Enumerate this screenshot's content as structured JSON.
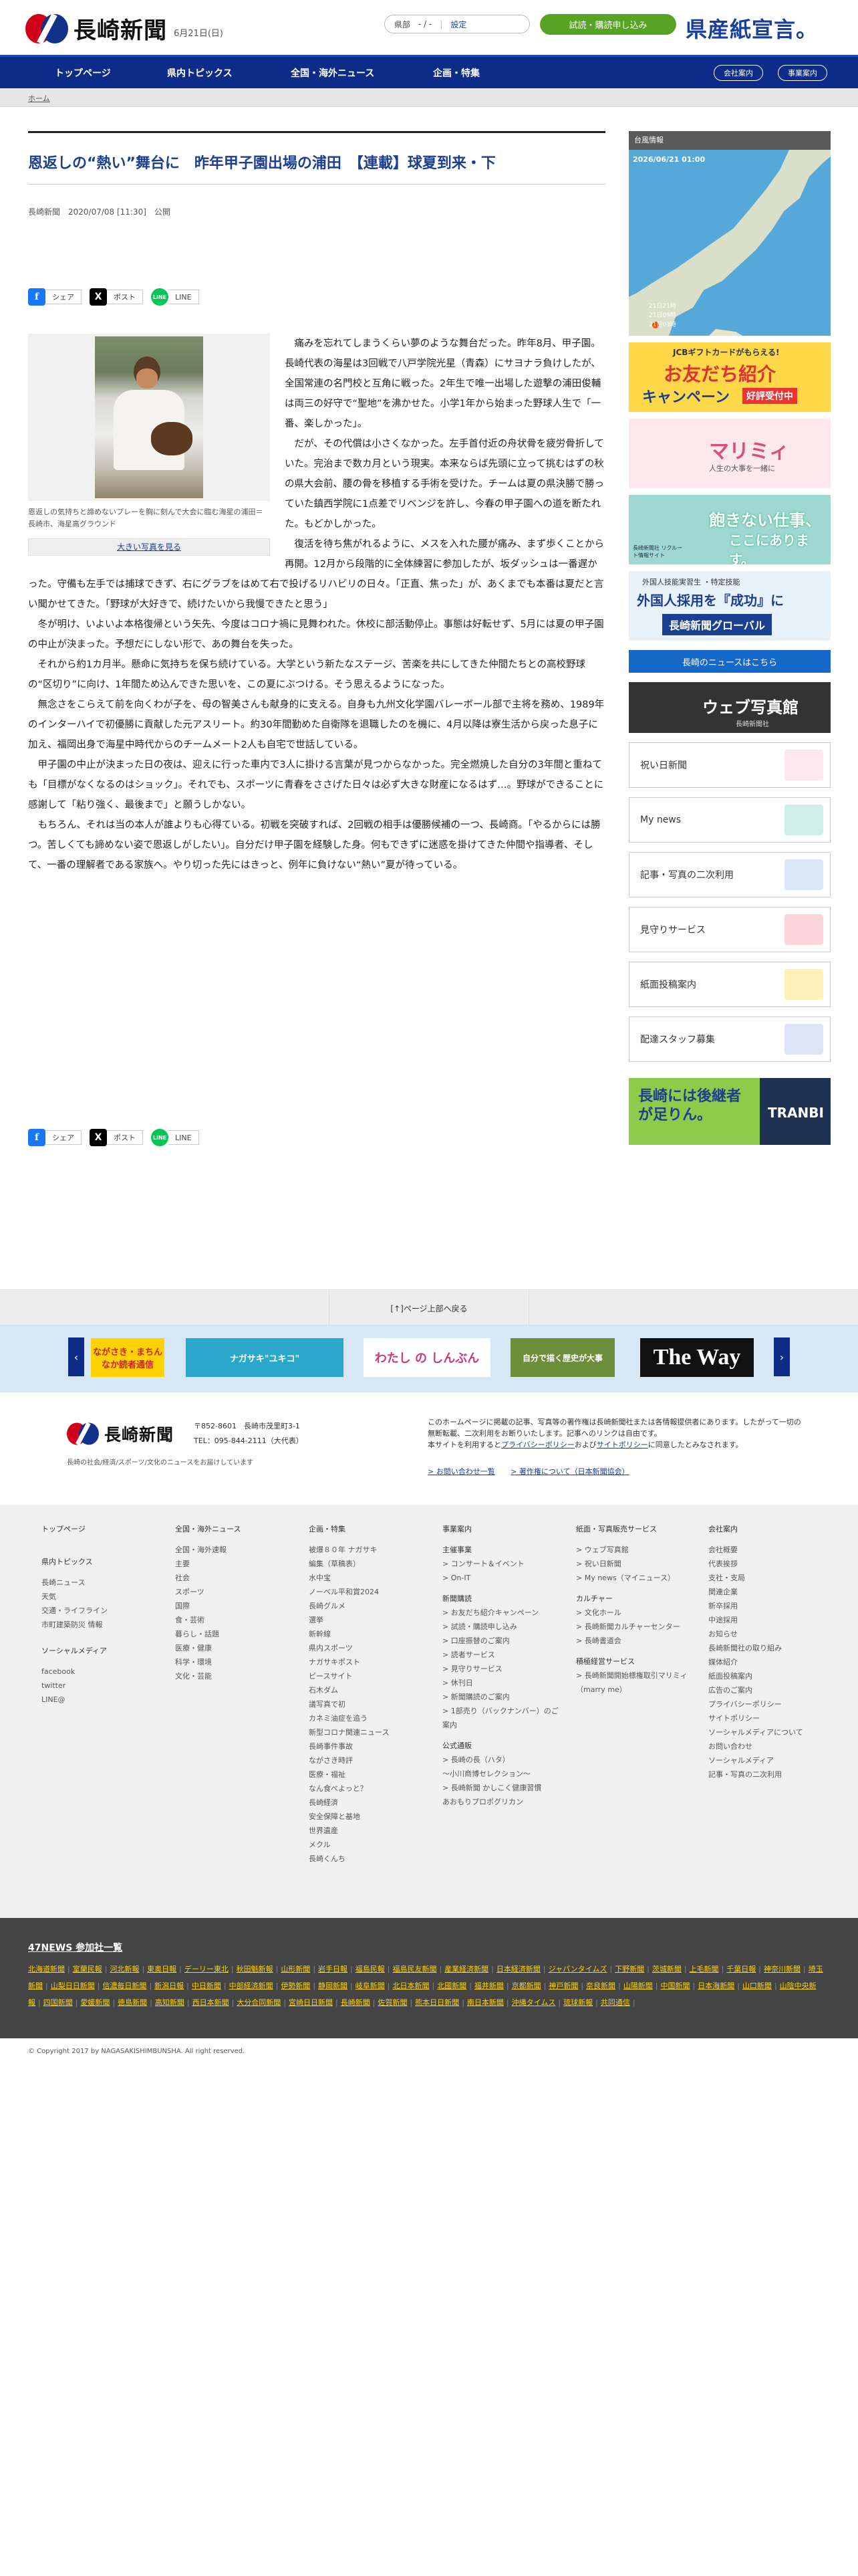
{
  "header": {
    "logo": "長崎新聞",
    "date": "6月21日(日)",
    "weather_region": "県部",
    "weather_value": "- / -",
    "weather_setting": "設定",
    "trial_button": "試読・購読申し込み",
    "kensan": "県産紙宣言。"
  },
  "nav": {
    "items": [
      "トップページ",
      "県内トピックス",
      "全国・海外ニュース",
      "企画・特集"
    ],
    "company": "会社案内",
    "business": "事業案内"
  },
  "breadcrumb": "ホーム",
  "article": {
    "headline": "恩返しの“熱い”舞台に　昨年甲子園出場の浦田　【連載】球夏到来・下",
    "byline": "長崎新聞　2020/07/08 [11:30]　公開",
    "share": {
      "facebook": "シェア",
      "x": "ポスト",
      "line": "LINE",
      "line_icon": "LINE"
    },
    "caption": "恩返しの気持ちと諦めないプレーを胸に刻んで大会に臨む海星の浦田＝長崎市、海星高グラウンド",
    "big_photo": "大きい写真を見る",
    "paragraphs": [
      "痛みを忘れてしまうくらい夢のような舞台だった。昨年8月、甲子園。長崎代表の海星は3回戦で八戸学院光星（青森）にサヨナラ負けしたが、全国常連の名門校と互角に戦った。2年生で唯一出場した遊撃の浦田俊輔は両三の好守で“聖地”を沸かせた。小学1年から始まった野球人生で「一番、楽しかった」。",
      "だが、その代償は小さくなかった。左手首付近の舟状骨を疲労骨折していた。完治まで数カ月という現実。本来ならば先頭に立って挑むはずの秋の県大会前、腰の骨を移植する手術を受けた。チームは夏の県決勝で勝っていた鎮西学院に1点差でリベンジを許し、今春の甲子園への道を断たれた。もどかしかった。",
      "復活を待ち焦がれるように、メスを入れた腰が痛み、まず歩くことから再開。12月から段階的に全体練習に参加したが、坂ダッシュは一番遅かった。守備も左手では捕球できず、右にグラブをはめて右で投げるリハビリの日々。「正直、焦った」が、あくまでも本番は夏だと言い聞かせてきた。「野球が大好きで、続けたいから我慢できたと思う」",
      "冬が明け、いよいよ本格復帰という矢先、今度はコロナ禍に見舞われた。休校に部活動停止。事態は好転せず、5月には夏の甲子園の中止が決まった。予想だにしない形で、あの舞台を失った。",
      "それから約1カ月半。懸命に気持ちを保ち続けている。大学という新たなステージ、苦楽を共にしてきた仲間たちとの高校野球の“区切り”に向け、1年間ため込んできた思いを、この夏にぶつける。そう思えるようになった。",
      "無念さをこらえて前を向くわが子を、母の智美さんも献身的に支える。自身も九州文化学園バレーボール部で主将を務め、1989年のインターハイで初優勝に貢献した元アスリート。約30年間勤めた自衛隊を退職したのを機に、4月以降は寮生活から戻った息子に加え、福岡出身で海星中時代からのチームメート2人も自宅で世話している。",
      "甲子園の中止が決まった日の夜は、迎えに行った車内で3人に掛ける言葉が見つからなかった。完全燃焼した自分の3年間と重ねても「目標がなくなるのはショック」。それでも、スポーツに青春をささげた日々は必ず大きな財産になるはず…。野球ができることに感謝して「粘り強く、最後まで」と願うしかない。",
      "もちろん、それは当の本人が誰よりも心得ている。初戦を突破すれば、2回戦の相手は優勝候補の一つ、長崎商。「やるからには勝つ。苦しくても諦めない姿で恩返しがしたい」。自分だけ甲子園を経験した身。何もできずに迷惑を掛けてきた仲間や指導者、そして、一番の理解者である家族へ。やり切った先にはきっと、例年に負けない“熱い”夏が待っている。"
    ]
  },
  "sidebar": {
    "typhoon_title": "台風情報",
    "typhoon_date": "2026/06/21 01:00",
    "ads": {
      "jcb_top": "JCBギフトカードがもらえる!",
      "jcb_main": "お友だち紹介",
      "jcb_sub": "キャンペーン",
      "jcb_badge": "好評受付中",
      "marimi": "マリミィ",
      "marimi_sub": "人生の大事を一緒に",
      "recruit_main": "飽きない仕事、",
      "recruit_sub": "ここにあります。",
      "recruit_org": "長崎新聞社 リクルート情報サイト",
      "global_sub": "外国人技能実習生 ・特定技能",
      "global_main": "外国人採用を『成功』に",
      "global_org": "長崎新聞グローバル",
      "webphoto_main": "ウェブ写真館",
      "webphoto_sub": "長崎新聞社",
      "tranbi_main": "長崎には後継者が足りん。",
      "tranbi_logo": "TRANBI"
    },
    "nagasaki_news": "長崎のニュースはこちら",
    "services": [
      "祝い日新聞",
      "My news",
      "記事・写真の二次利用",
      "見守りサービス",
      "紙面投稿案内",
      "配達スタッフ募集"
    ]
  },
  "pagetop": "[↑]ページ上部へ戻る",
  "banners": [
    "ながさき・まちんなか読者通信",
    "ナガサキ\"ユキコ\"",
    "わたし の しんぶん",
    "自分で描く歴史が大事",
    "The Way"
  ],
  "footer": {
    "logo": "長崎新聞",
    "zip": "〒852-8601　長崎市茂里町3-1",
    "tel": "TEL：095-844-2111（大代表）",
    "tagline": "長崎の社会/経済/スポーツ/文化のニュースをお届けしています",
    "info": "このホームページに掲載の記事、写真等の著作権は長崎新聞社または各情報提供者にあります。したがって一切の無断転載、二次利用をお断りいたします。記事へのリンクは自由です。",
    "info2_pre": "本サイトを利用すると",
    "privacy": "プライバシーポリシー",
    "info2_mid": "および",
    "sitepolicy": "サイトポリシー",
    "info2_post": "に同意したとみなされます。",
    "contact": "> お問い合わせ一覧",
    "copyright_link": "> 著作権について（日本新聞協会）"
  },
  "sitemap": {
    "col1": {
      "a": "トップページ",
      "b": "県内トピックス",
      "b_items": [
        "長崎ニュース",
        "天気",
        "交通・ライフライン",
        "市町建築防災 情報"
      ],
      "c": "ソーシャルメディア",
      "c_items": [
        "facebook",
        "twitter",
        "LINE@"
      ]
    },
    "col2": {
      "h": "全国・海外ニュース",
      "items": [
        "全国・海外速報",
        "主要",
        "社会",
        "スポーツ",
        "国際",
        "食・芸術",
        "暮らし・話題",
        "医療・健康",
        "科学・環境",
        "文化・芸能"
      ]
    },
    "col3": {
      "h": "企画・特集",
      "items": [
        "被爆８０年 ナガサキ",
        "編集（草稿表）",
        "水中宝",
        "ノーベル平和賞2024",
        "長崎グルメ",
        "選挙",
        "新幹線",
        "県内スポーツ",
        "ナガサキポスト",
        "ピースサイト",
        "石木ダム",
        "議写真で初",
        "カネミ油症を追う",
        "新型コロナ関連ニュース",
        "長崎事件事故",
        "ながさき時評",
        "医療・福祉",
        "なん食べよっと？",
        "長崎経済",
        "安全保障と基地",
        "世界遺産",
        "メクル",
        "長崎くんち"
      ]
    },
    "col4": {
      "h": "事業案内",
      "g1": "主催事業",
      "g1_items": [
        "> コンサート＆イベント",
        "> On-IT"
      ],
      "g2": "新聞購読",
      "g2_items": [
        "> お友だち紹介キャンペーン",
        "> 試読・購読申し込み",
        "> 口座振替のご案内",
        "> 読者サービス",
        "> 見守りサービス",
        "> 休刊日",
        "> 新聞購読のご案内",
        "> 1部売り（バックナンバー）のご案内"
      ],
      "g3": "公式通販",
      "g3_items": [
        "> 長崎の長（ハタ）",
        "〜小川商博セレクション〜",
        "> 長崎新聞 かしこく健康習慣",
        "あおもりプロポグリカン"
      ]
    },
    "col5": {
      "h": "紙面・写真販売サービス",
      "items1": [
        "> ウェブ写真館",
        "> 祝い日新聞",
        "> My news（マイニュース）"
      ],
      "g2": "カルチャー",
      "g2_items": [
        "> 文化ホール",
        "> 長崎新聞カルチャーセンター",
        "> 長崎書道会"
      ],
      "g3": "積極経営サービス",
      "g3_items": [
        "> 長崎新聞開始標権取引マリミィ（marry me）"
      ]
    },
    "col6": {
      "h": "会社案内",
      "items": [
        "会社概要",
        "代表挨拶",
        "支社・支局",
        "関連企業",
        "新卒採用",
        "中途採用",
        "お知らせ",
        "長崎新聞社の取り組み",
        "媒体紹介",
        "紙面投稿案内",
        "広告のご案内",
        "プライバシーポリシー",
        "サイトポリシー",
        "ソーシャルメディアについて",
        "お問い合わせ",
        "ソーシャルメディア",
        "記事・写真の二次利用"
      ]
    }
  },
  "news47": {
    "title": "47NEWS 参加社一覧",
    "members": [
      "北海道新聞",
      "室蘭民報",
      "河北新報",
      "東奥日報",
      "デーリー東北",
      "秋田魁新報",
      "山形新聞",
      "岩手日報",
      "福島民報",
      "福島民友新聞",
      "産業経済新聞",
      "日本経済新聞",
      "ジャパンタイムズ",
      "下野新聞",
      "茨城新聞",
      "上毛新聞",
      "千葉日報",
      "神奈川新聞",
      "埼玉新聞",
      "山梨日日新聞",
      "信濃毎日新聞",
      "新潟日報",
      "中日新聞",
      "中部経済新聞",
      "伊勢新聞",
      "静岡新聞",
      "岐阜新聞",
      "北日本新聞",
      "北國新聞",
      "福井新聞",
      "京都新聞",
      "神戸新聞",
      "奈良新聞",
      "山陽新聞",
      "中国新聞",
      "日本海新聞",
      "山口新聞",
      "山陰中央新報",
      "四国新聞",
      "愛媛新聞",
      "徳島新聞",
      "高知新聞",
      "西日本新聞",
      "大分合同新聞",
      "宮崎日日新聞",
      "長崎新聞",
      "佐賀新聞",
      "熊本日日新聞",
      "南日本新聞",
      "沖縄タイムス",
      "琉球新報",
      "共同通信"
    ]
  },
  "copyright": "© Copyright 2017 by NAGASAKISHIMBUNSHA. All right reserved."
}
